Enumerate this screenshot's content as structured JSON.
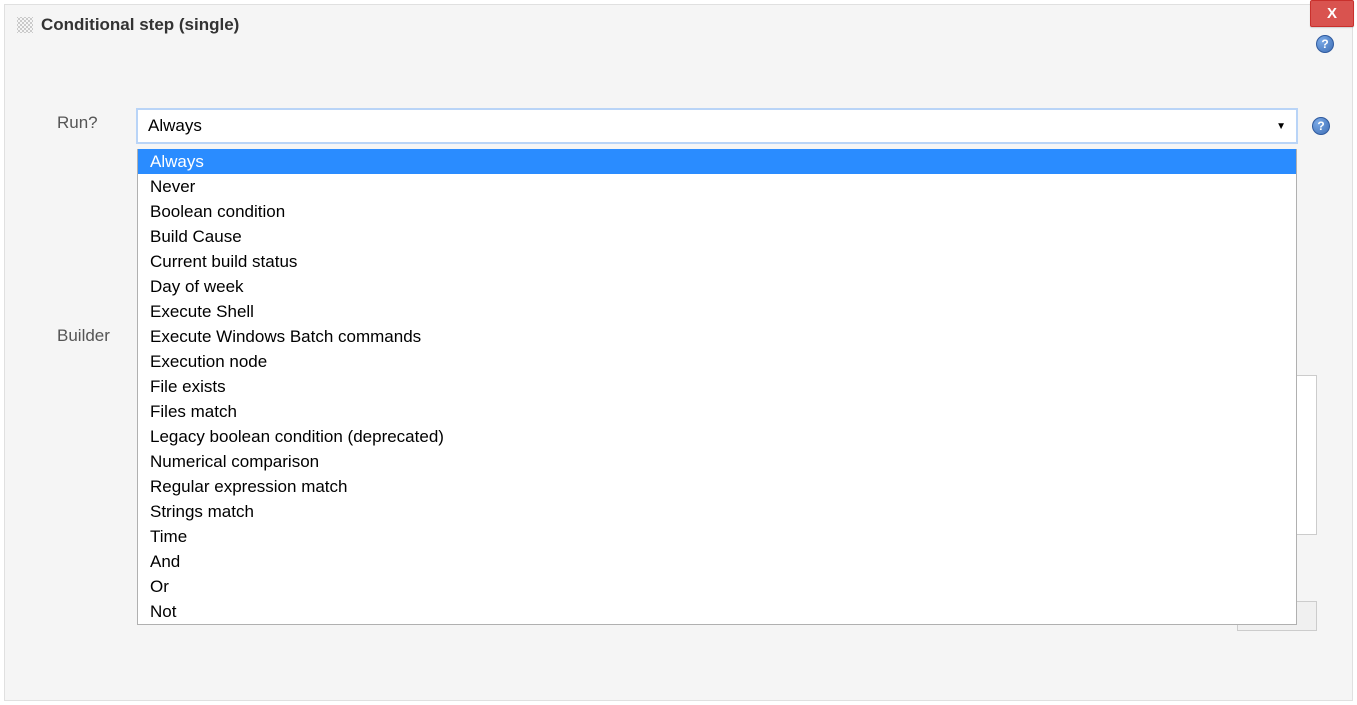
{
  "panel": {
    "title": "Conditional step (single)",
    "close_label": "X"
  },
  "help_glyph": "?",
  "labels": {
    "run": "Run?",
    "builder": "Builder"
  },
  "run_select": {
    "value": "Always",
    "options": [
      "Always",
      "Never",
      "Boolean condition",
      "Build Cause",
      "Current build status",
      "Day of week",
      "Execute Shell",
      "Execute Windows Batch commands",
      "Execution node",
      "File exists",
      "Files match",
      "Legacy boolean condition (deprecated)",
      "Numerical comparison",
      "Regular expression match",
      "Strings match",
      "Time",
      "And",
      "Or",
      "Not"
    ],
    "selected_index": 0
  }
}
